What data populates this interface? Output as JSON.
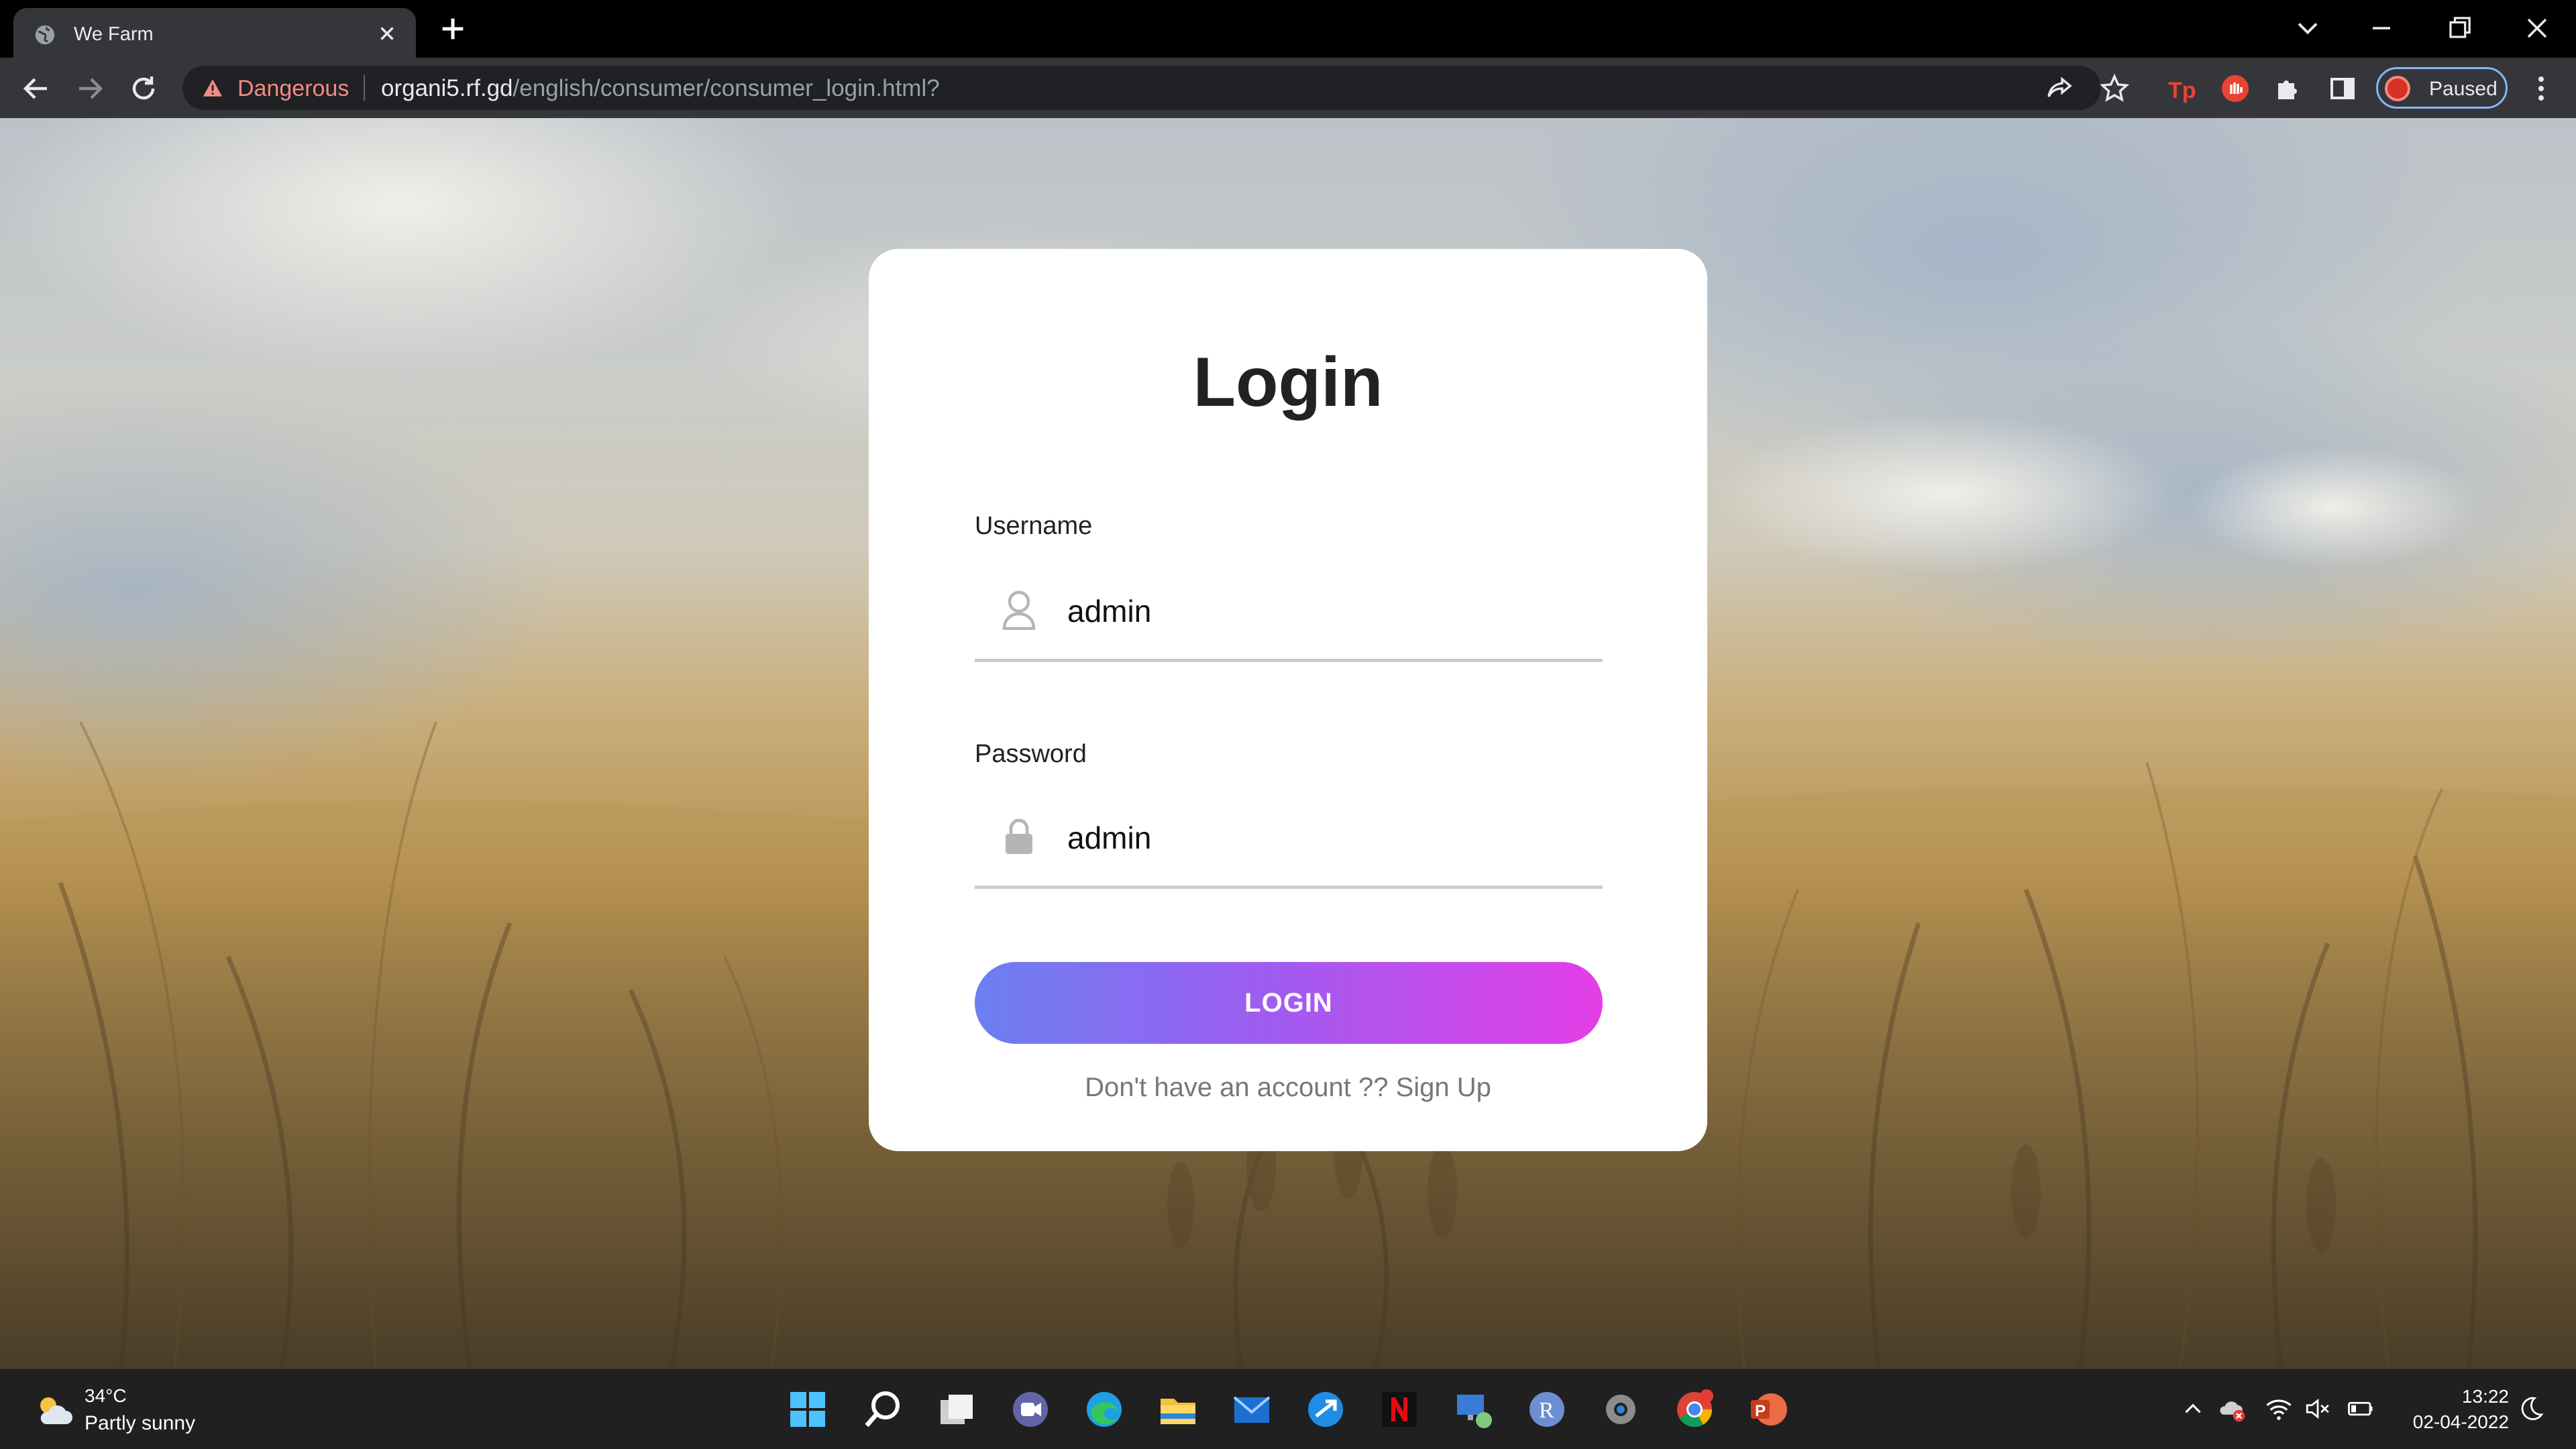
{
  "browser": {
    "tab_title": "We Farm",
    "security_label": "Dangerous",
    "url_host": "organi5.rf.gd",
    "url_path": "/english/consumer/consumer_login.html?",
    "profile_status": "Paused"
  },
  "login": {
    "title": "Login",
    "username_label": "Username",
    "username_value": "admin",
    "password_label": "Password",
    "password_value": "admin",
    "button_label": "LOGIN",
    "signup_text": "Don't have an account ?? Sign Up"
  },
  "taskbar": {
    "weather_temp": "34°C",
    "weather_condition": "Partly sunny",
    "time": "13:22",
    "date": "02-04-2022"
  }
}
